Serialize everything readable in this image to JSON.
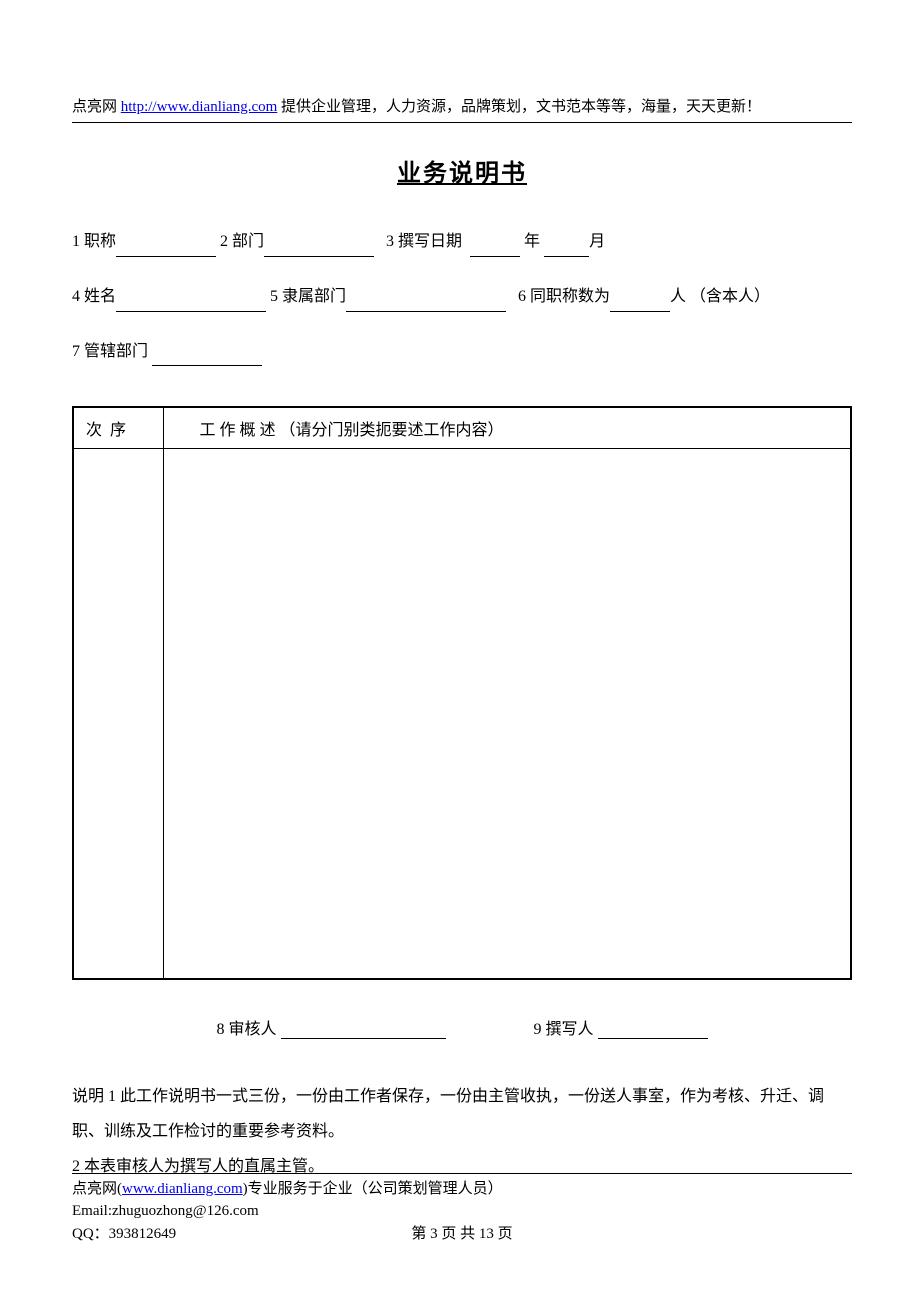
{
  "header": {
    "prefix": "点亮网 ",
    "link_text": "http://www.dianliang.com",
    "suffix": " 提供企业管理，人力资源，品牌策划，文书范本等等，海量，天天更新！"
  },
  "title": "业务说明书",
  "form": {
    "f1": "1 职称",
    "f2": "2 部门",
    "f3": "3 撰写日期",
    "f3_year": "年",
    "f3_month": "月",
    "f4": "4 姓名",
    "f5": "5 隶属部门",
    "f6": "6 同职称数为",
    "f6_suffix": "人 （含本人）",
    "f7": "7 管辖部门"
  },
  "table": {
    "col1": "次 序",
    "col2": "工 作 概 述 （请分门别类扼要述工作内容）"
  },
  "sign": {
    "s8": "8 审核人",
    "s9": "9 撰写人"
  },
  "notes": {
    "n1": "说明 1 此工作说明书一式三份，一份由工作者保存，一份由主管收执，一份送人事室，作为考核、升迁、调职、训练及工作检讨的重要参考资料。",
    "n2": "2 本表审核人为撰写人的直属主管。"
  },
  "footer": {
    "line1_prefix": "点亮网(",
    "line1_link": "www.dianliang.com",
    "line1_suffix": ")专业服务于企业（公司策划管理人员）",
    "line2": "Email:zhuguozhong@126.com",
    "line3": "QQ：393812649",
    "page": "第 3 页 共 13 页"
  }
}
